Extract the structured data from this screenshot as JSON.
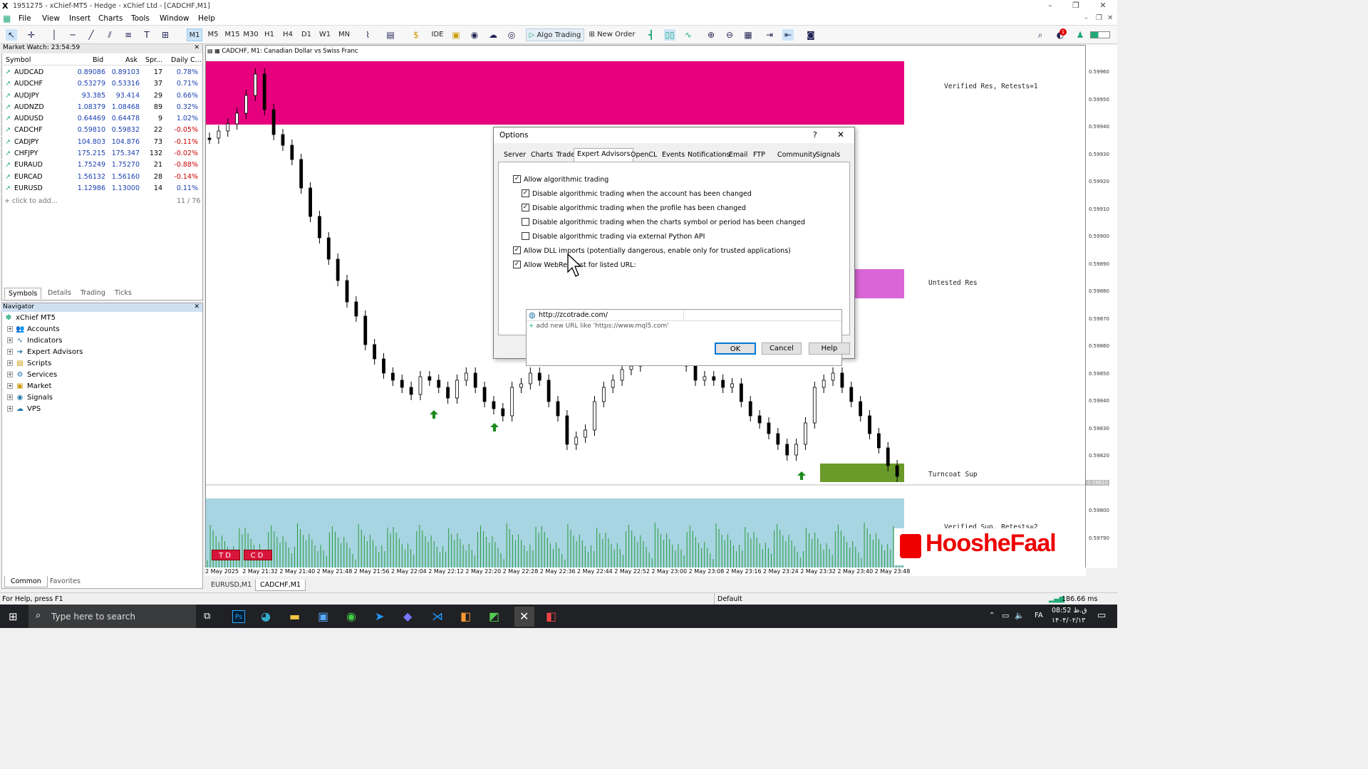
{
  "title_bar": {
    "app_icon": "X",
    "title": "1951275 - xChief-MT5 - Hedge - xChief Ltd - [CADCHF,M1]"
  },
  "menu": [
    "File",
    "View",
    "Insert",
    "Charts",
    "Tools",
    "Window",
    "Help"
  ],
  "toolbar": {
    "timeframes": [
      "M1",
      "M5",
      "M15",
      "M30",
      "H1",
      "H4",
      "D1",
      "W1",
      "MN"
    ],
    "selected_timeframe": "M1",
    "ide_label": "IDE",
    "algo_trading_label": "Algo Trading",
    "new_order_label": "New Order",
    "notification_count": "1"
  },
  "market_watch": {
    "header": "Market Watch: 23:54:59",
    "columns": [
      "Symbol",
      "Bid",
      "Ask",
      "Spr...",
      "Daily C..."
    ],
    "rows": [
      {
        "symbol": "AUDCAD",
        "bid": "0.89086",
        "ask": "0.89103",
        "spread": "17",
        "change": "0.78%"
      },
      {
        "symbol": "AUDCHF",
        "bid": "0.53279",
        "ask": "0.53316",
        "spread": "37",
        "change": "0.71%"
      },
      {
        "symbol": "AUDJPY",
        "bid": "93.385",
        "ask": "93.414",
        "spread": "29",
        "change": "0.66%"
      },
      {
        "symbol": "AUDNZD",
        "bid": "1.08379",
        "ask": "1.08468",
        "spread": "89",
        "change": "0.32%"
      },
      {
        "symbol": "AUDUSD",
        "bid": "0.64469",
        "ask": "0.64478",
        "spread": "9",
        "change": "1.02%"
      },
      {
        "symbol": "CADCHF",
        "bid": "0.59810",
        "ask": "0.59832",
        "spread": "22",
        "change": "-0.05%"
      },
      {
        "symbol": "CADJPY",
        "bid": "104.803",
        "ask": "104.876",
        "spread": "73",
        "change": "-0.11%"
      },
      {
        "symbol": "CHFJPY",
        "bid": "175.215",
        "ask": "175.347",
        "spread": "132",
        "change": "-0.02%"
      },
      {
        "symbol": "EURAUD",
        "bid": "1.75249",
        "ask": "1.75270",
        "spread": "21",
        "change": "-0.88%"
      },
      {
        "symbol": "EURCAD",
        "bid": "1.56132",
        "ask": "1.56160",
        "spread": "28",
        "change": "-0.14%"
      },
      {
        "symbol": "EURUSD",
        "bid": "1.12986",
        "ask": "1.13000",
        "spread": "14",
        "change": "0.11%"
      }
    ],
    "add_label": "click to add...",
    "count": "11 / 76",
    "tabs": [
      "Symbols",
      "Details",
      "Trading",
      "Ticks"
    ]
  },
  "navigator": {
    "header": "Navigator",
    "root": "xChief MT5",
    "items": [
      "Accounts",
      "Indicators",
      "Expert Advisors",
      "Scripts",
      "Services",
      "Market",
      "Signals",
      "VPS"
    ],
    "tabs": [
      "Common",
      "Favorites"
    ]
  },
  "chart": {
    "title": "CADCHF, M1:  Canadian Dollar vs Swiss Franc",
    "zone_labels": [
      "Verified Res, Retests=1",
      "Untested Res",
      "Turncoat Sup",
      "Verified Sup, Retests=2"
    ],
    "buttons": [
      "TD",
      "CD"
    ],
    "y_ticks": [
      "0.59960",
      "0.59950",
      "0.59940",
      "0.59930",
      "0.59920",
      "0.59910",
      "0.59900",
      "0.59890",
      "0.59880",
      "0.59870",
      "0.59860",
      "0.59850",
      "0.59840",
      "0.59830",
      "0.59820",
      "0.59810",
      "0.59800",
      "0.59790"
    ],
    "current_price": "0.59810",
    "x_ticks": [
      "2 May 2025",
      "2 May 21:32",
      "2 May 21:40",
      "2 May 21:48",
      "2 May 21:56",
      "2 May 22:04",
      "2 May 22:12",
      "2 May 22:20",
      "2 May 22:28",
      "2 May 22:36",
      "2 May 22:44",
      "2 May 22:52",
      "2 May 23:00",
      "2 May 23:08",
      "2 May 23:16",
      "2 May 23:24",
      "2 May 23:32",
      "2 May 23:40",
      "2 May 23:48"
    ],
    "tabs": [
      "EURUSD,M1",
      "CADCHF,M1"
    ],
    "watermark": "HoosheFaal",
    "colors": {
      "resistance": "#e6007e",
      "untested": "#d966d6",
      "support": "#6a9a2a",
      "volume_bg": "#a8d5e2",
      "volume": "#2a9a3a",
      "arrow": "#1a8a1a"
    }
  },
  "dialog": {
    "title": "Options",
    "help": "?",
    "tabs": [
      "Server",
      "Charts",
      "Trade",
      "Expert Advisors",
      "OpenCL",
      "Events",
      "Notifications",
      "Email",
      "FTP",
      "Community",
      "Signals"
    ],
    "active_tab": "Expert Advisors",
    "options": [
      {
        "label": "Allow algorithmic trading",
        "checked": true,
        "indent": 0
      },
      {
        "label": "Disable algorithmic trading when the account has been changed",
        "checked": true,
        "indent": 1
      },
      {
        "label": "Disable algorithmic trading when the profile has been changed",
        "checked": true,
        "indent": 1
      },
      {
        "label": "Disable algorithmic trading when the charts symbol or period has been changed",
        "checked": false,
        "indent": 1
      },
      {
        "label": "Disable algorithmic trading via external Python API",
        "checked": false,
        "indent": 1
      },
      {
        "label": "Allow DLL imports (potentially dangerous, enable only for trusted applications)",
        "checked": true,
        "indent": 0
      },
      {
        "label": "Allow WebRequest for listed URL:",
        "checked": true,
        "indent": 0
      }
    ],
    "urls": [
      "http://zcotrade.com/"
    ],
    "add_url": "add new URL like 'https://www.mql5.com'",
    "buttons": {
      "ok": "OK",
      "cancel": "Cancel",
      "help": "Help"
    }
  },
  "status_bar": {
    "help": "For Help, press F1",
    "profile": "Default",
    "ping": "186.66 ms"
  },
  "taskbar": {
    "search_placeholder": "Type here to search",
    "time": "08:52 ق.ظ",
    "date": "۱۴۰۴/۰۲/۱۳",
    "lang": "FA"
  }
}
